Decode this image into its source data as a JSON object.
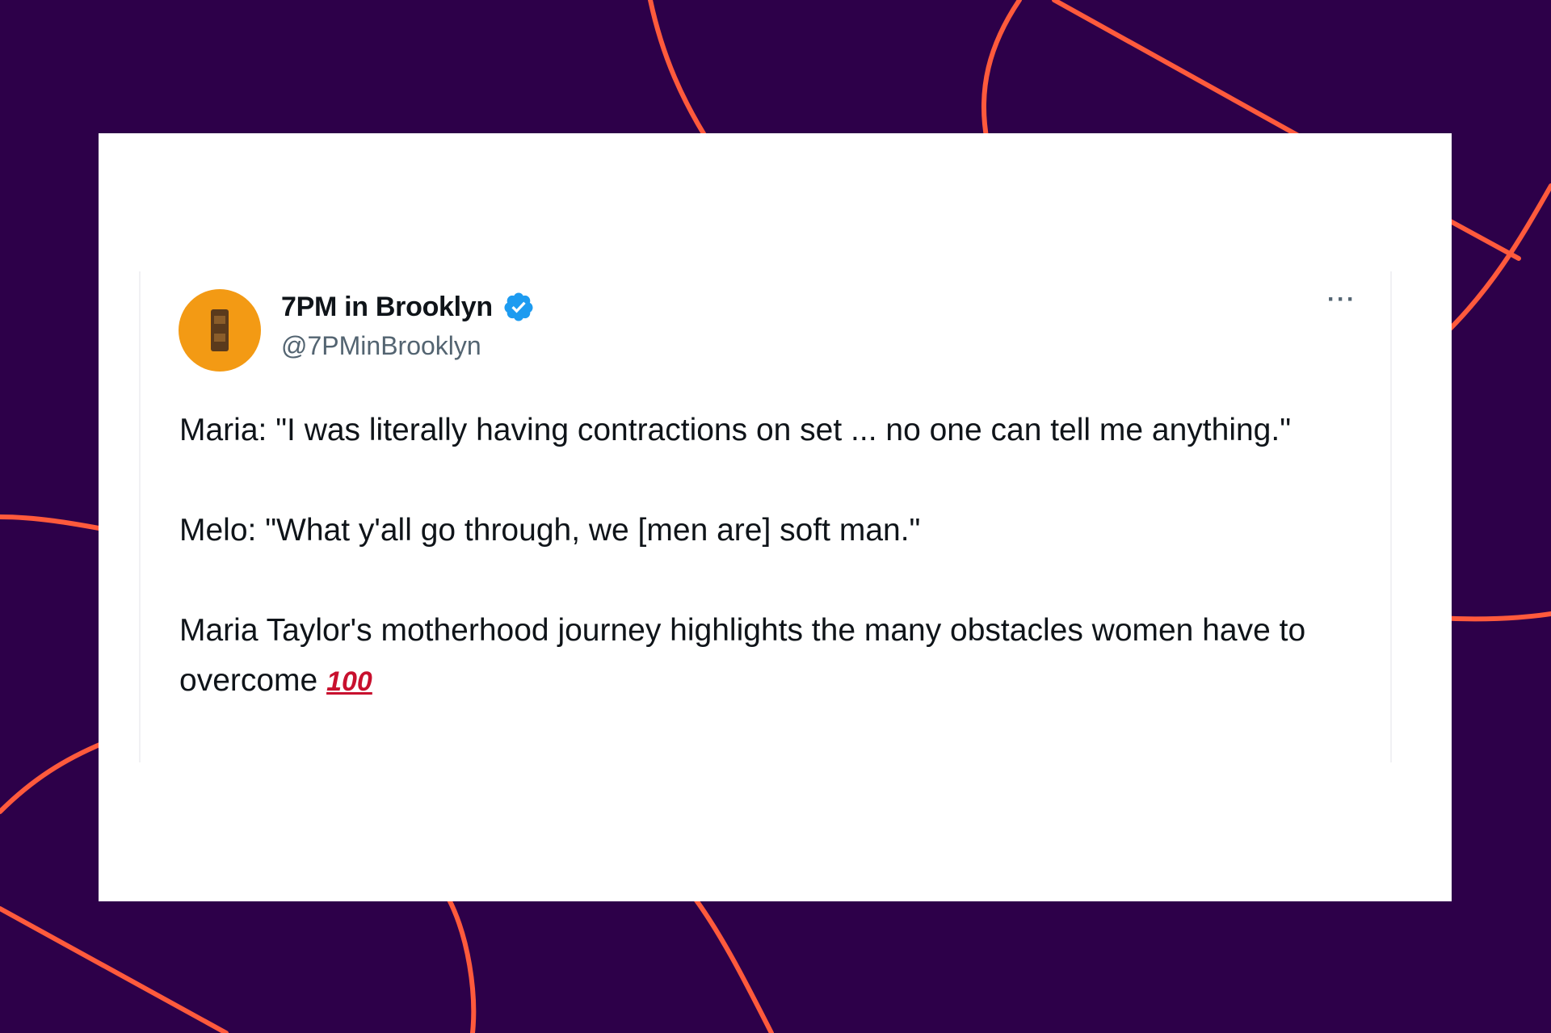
{
  "tweet": {
    "display_name": "7PM in Brooklyn",
    "handle": "@7PMinBrooklyn",
    "more_label": "···",
    "paragraphs": [
      "Maria: \"I was literally having contractions on set ... no one can tell me anything.\"",
      "Melo: \"What y'all go through, we [men are] soft man.\"",
      "Maria Taylor's motherhood journey highlights the many obstacles women have to overcome"
    ],
    "emoji": "100"
  },
  "colors": {
    "background": "#2d0049",
    "accent_lines": "#ff5a3c",
    "avatar": "#f39a14",
    "verified": "#1d9bf0"
  },
  "icons": {
    "verified": "verified-badge-icon",
    "more": "more-options-icon",
    "emoji": "hundred-points-icon"
  }
}
